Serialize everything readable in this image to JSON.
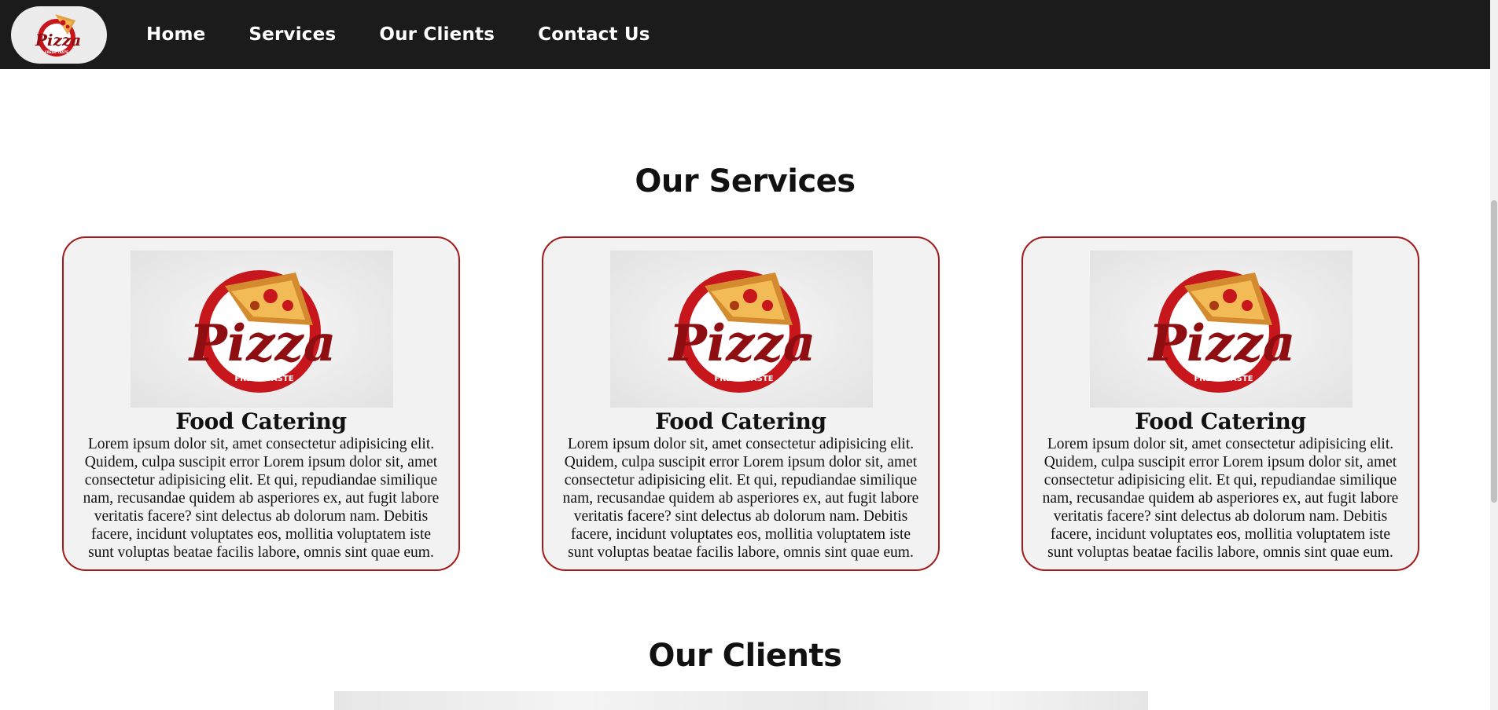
{
  "nav": {
    "logo_alt": "pizza-logo",
    "links": [
      {
        "label": "Home"
      },
      {
        "label": "Services"
      },
      {
        "label": "Our Clients"
      },
      {
        "label": "Contact Us"
      }
    ]
  },
  "services": {
    "title": "Our Services",
    "cards": [
      {
        "title": "Food Catering",
        "text": "Lorem ipsum dolor sit, amet consectetur adipisicing elit. Quidem, culpa suscipit error Lorem ipsum dolor sit, amet consectetur adipisicing elit. Et qui, repudiandae similique nam, recusandae quidem ab asperiores ex, aut fugit labore veritatis facere? sint delectus ab dolorum nam. Debitis facere, incidunt voluptates eos, mollitia voluptatem iste sunt voluptas beatae facilis labore, omnis sint quae eum."
      },
      {
        "title": "Food Catering",
        "text": "Lorem ipsum dolor sit, amet consectetur adipisicing elit. Quidem, culpa suscipit error Lorem ipsum dolor sit, amet consectetur adipisicing elit. Et qui, repudiandae similique nam, recusandae quidem ab asperiores ex, aut fugit labore veritatis facere? sint delectus ab dolorum nam. Debitis facere, incidunt voluptates eos, mollitia voluptatem iste sunt voluptas beatae facilis labore, omnis sint quae eum."
      },
      {
        "title": "Food Catering",
        "text": "Lorem ipsum dolor sit, amet consectetur adipisicing elit. Quidem, culpa suscipit error Lorem ipsum dolor sit, amet consectetur adipisicing elit. Et qui, repudiandae similique nam, recusandae quidem ab asperiores ex, aut fugit labore veritatis facere? sint delectus ab dolorum nam. Debitis facere, incidunt voluptates eos, mollitia voluptatem iste sunt voluptas beatae facilis labore, omnis sint quae eum."
      }
    ]
  },
  "clients": {
    "title": "Our Clients"
  },
  "logo": {
    "word": "Pizza",
    "tagline": "FRESH TASTE"
  },
  "colors": {
    "navbar": "#1b1b1b",
    "card_border": "#a31b1b",
    "card_bg": "#f2f2f2",
    "brand_red": "#c8161d"
  }
}
